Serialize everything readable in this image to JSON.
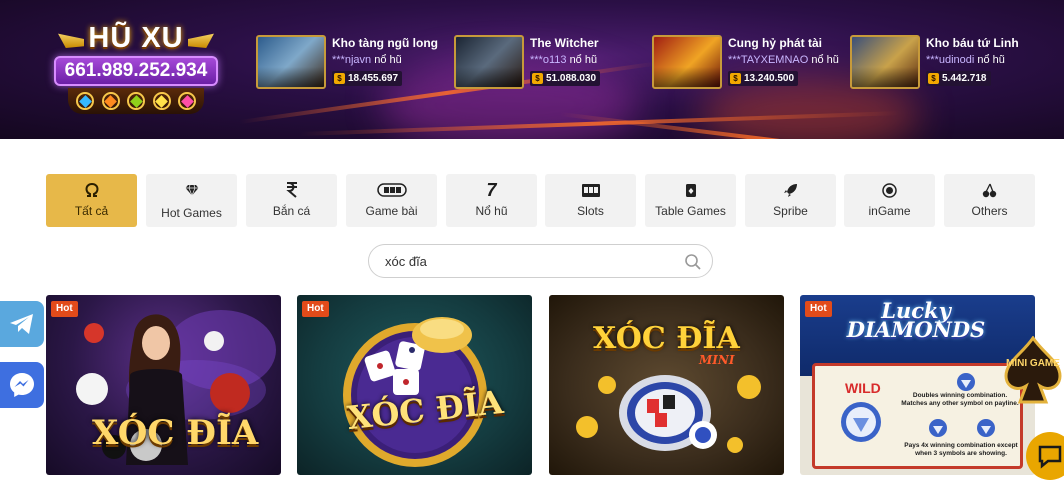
{
  "colors": {
    "accent": "#e7b849",
    "hot_badge": "#e24b1a",
    "telegram": "#5aa8de",
    "messenger": "#3e6fe0",
    "chat": "#e9a600"
  },
  "jackpot": {
    "title": "HŨ XU",
    "amount": "661.989.252.934",
    "gem_icons": [
      "blue-gem-icon",
      "orange-gem-icon",
      "green-gem-icon",
      "star-gem-icon",
      "pink-gem-icon"
    ],
    "winners": [
      {
        "game": "Kho tàng ngũ long",
        "user": "***njavn",
        "suffix": "nổ hũ",
        "amount": "18.455.697",
        "thumb_name": "kho-tang-ngu-long-thumbnail"
      },
      {
        "game": "The Witcher",
        "user": "***o113",
        "suffix": "nổ hũ",
        "amount": "51.088.030",
        "thumb_name": "the-witcher-thumbnail"
      },
      {
        "game": "Cung hỷ phát tài",
        "user": "***TAYXEMNAO",
        "suffix": "nổ hũ",
        "amount": "13.240.500",
        "thumb_name": "cung-hy-phat-tai-thumbnail"
      },
      {
        "game": "Kho báu tứ Linh",
        "user": "***udinodi",
        "suffix": "nổ hũ",
        "amount": "5.442.718",
        "thumb_name": "kho-bau-tu-linh-thumbnail"
      }
    ],
    "coin_symbol": "$"
  },
  "categories": [
    {
      "label": "Tất cả",
      "icon": "omega-icon",
      "active": true
    },
    {
      "label": "Hot Games",
      "icon": "diamond-icon",
      "active": false
    },
    {
      "label": "Bắn cá",
      "icon": "fish-shooting-icon",
      "active": false
    },
    {
      "label": "Game bài",
      "icon": "cards-icon",
      "active": false
    },
    {
      "label": "Nổ hũ",
      "icon": "seven-icon",
      "active": false
    },
    {
      "label": "Slots",
      "icon": "slot-machine-icon",
      "active": false
    },
    {
      "label": "Table Games",
      "icon": "table-game-icon",
      "active": false
    },
    {
      "label": "Spribe",
      "icon": "rocket-icon",
      "active": false
    },
    {
      "label": "inGame",
      "icon": "chip-icon",
      "active": false
    },
    {
      "label": "Others",
      "icon": "cherries-icon",
      "active": false
    }
  ],
  "search": {
    "value": "xóc đĩa",
    "placeholder": ""
  },
  "games": [
    {
      "title": "XÓC ĐĨA",
      "badge": "Hot",
      "style": "dealer"
    },
    {
      "title": "XÓC ĐĨA",
      "badge": "Hot",
      "style": "dice-bowl"
    },
    {
      "title": "XÓC ĐĨA",
      "subtitle": "MINI",
      "badge": "",
      "style": "plate"
    },
    {
      "title": "Lucky DIAMONDS",
      "badge": "Hot",
      "style": "diamonds",
      "wild_label": "WILD",
      "rule_1": "Doubles winning combination. Matches any other symbol on payline.",
      "rule_2": "Pays 4x winning combination except when 3 symbols are showing."
    }
  ],
  "floating": {
    "mini_game_label": "MINI GAME"
  }
}
